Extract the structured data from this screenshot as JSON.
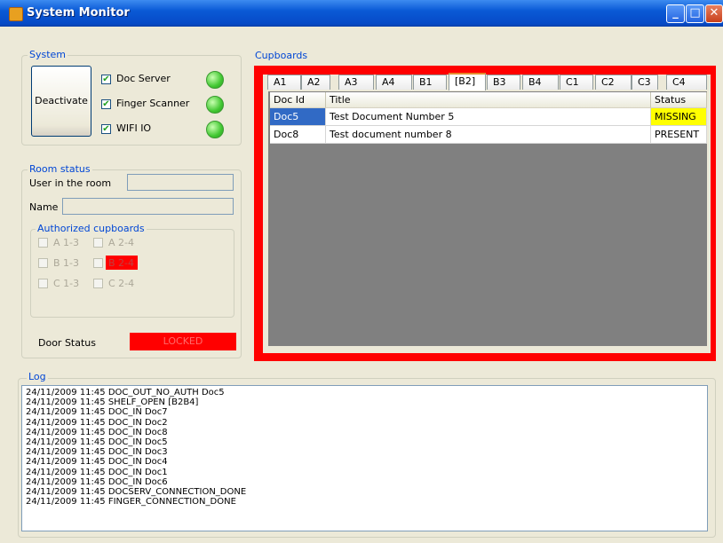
{
  "window": {
    "title": "System Monitor",
    "minimize": "_",
    "maximize": "□",
    "close": "✕",
    "icon": "app-icon"
  },
  "system": {
    "legend": "System",
    "deactivate_label": "Deactivate",
    "items": [
      {
        "label": "Doc Server",
        "checked": true,
        "status_color": "#42c832"
      },
      {
        "label": "Finger Scanner",
        "checked": true,
        "status_color": "#42c832"
      },
      {
        "label": "WIFI IO",
        "checked": true,
        "status_color": "#42c832"
      }
    ]
  },
  "room": {
    "legend": "Room status",
    "user_label": "User in the room",
    "user_value": "",
    "name_label": "Name",
    "name_value": "",
    "authorized_legend": "Authorized cupboards",
    "cupboards": [
      {
        "label": "A 1-3",
        "active": false
      },
      {
        "label": "A 2-4",
        "active": false
      },
      {
        "label": "B 1-3",
        "active": false
      },
      {
        "label": "B 2-4",
        "active": true,
        "color": "#ff0000"
      },
      {
        "label": "C 1-3",
        "active": false
      },
      {
        "label": "C 2-4",
        "active": false
      }
    ],
    "door_label": "Door Status",
    "door_value": "LOCKED",
    "door_color": "#ff0000"
  },
  "cupboards": {
    "legend": "Cupboards",
    "tabs": [
      "A1",
      "A2",
      "A3",
      "A4",
      "B1",
      "[B2]",
      "B3",
      "B4",
      "C1",
      "C2",
      "C3",
      "C4"
    ],
    "selected_tab": "[B2]",
    "columns": [
      "Doc Id",
      "Title",
      "Status"
    ],
    "rows": [
      {
        "doc_id": "Doc5",
        "title": "Test Document Number 5",
        "status": "MISSING",
        "status_color": "#ffff00"
      },
      {
        "doc_id": "Doc8",
        "title": "Test document number 8",
        "status": "PRESENT",
        "status_color": "#ffffff"
      }
    ],
    "alert_color": "#ff0000"
  },
  "log": {
    "legend": "Log",
    "lines": [
      "24/11/2009 11:45 DOC_OUT_NO_AUTH Doc5",
      "24/11/2009 11:45 SHELF_OPEN [B2B4]",
      "24/11/2009 11:45 DOC_IN Doc7",
      "24/11/2009 11:45 DOC_IN Doc2",
      "24/11/2009 11:45 DOC_IN Doc8",
      "24/11/2009 11:45 DOC_IN Doc5",
      "24/11/2009 11:45 DOC_IN Doc3",
      "24/11/2009 11:45 DOC_IN Doc4",
      "24/11/2009 11:45 DOC_IN Doc1",
      "24/11/2009 11:45 DOC_IN Doc6",
      "24/11/2009 11:45 DOCSERV_CONNECTION_DONE",
      "24/11/2009 11:45 FINGER_CONNECTION_DONE"
    ]
  }
}
